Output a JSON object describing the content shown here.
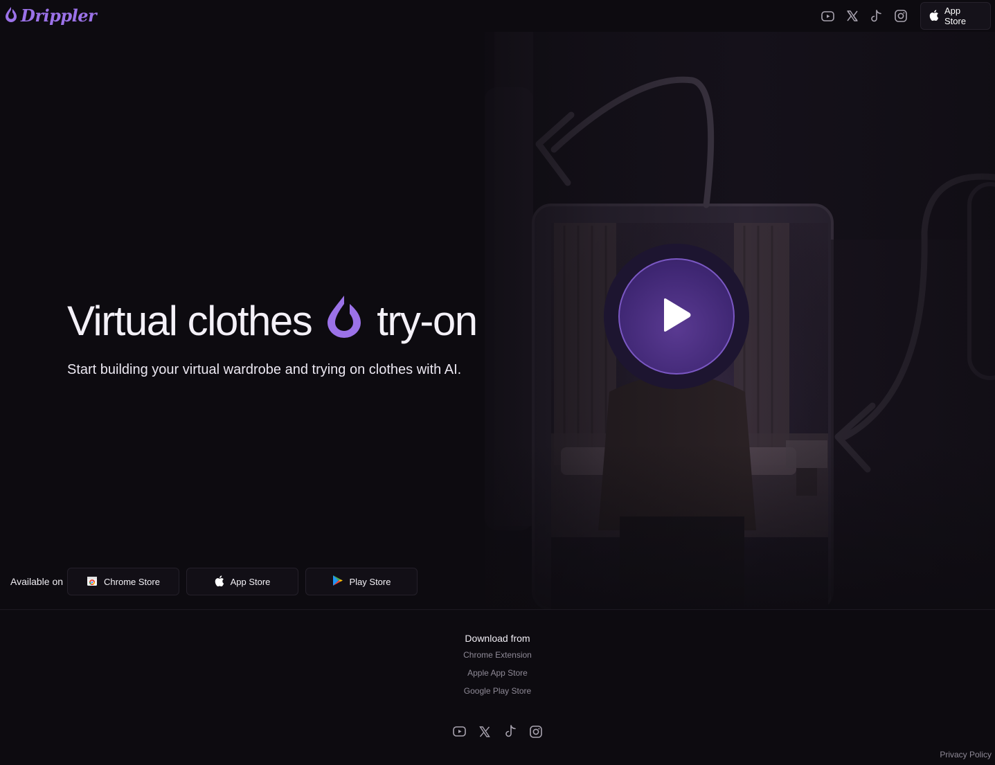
{
  "brand": {
    "name": "Drippler",
    "accent": "#9b72e8"
  },
  "header": {
    "social": [
      "youtube-icon",
      "x-icon",
      "tiktok-icon",
      "instagram-icon"
    ],
    "app_store_label": "App Store"
  },
  "hero": {
    "title_left": "Virtual clothes",
    "title_right": "try-on",
    "subtitle": "Start building your virtual wardrobe and trying on clothes with AI."
  },
  "available": {
    "label": "Available on",
    "stores": [
      {
        "label": "Chrome Store",
        "icon": "chrome-store-icon"
      },
      {
        "label": "App Store",
        "icon": "apple-icon"
      },
      {
        "label": "Play Store",
        "icon": "google-play-icon"
      }
    ]
  },
  "footer": {
    "heading": "Download from",
    "links": [
      "Chrome Extension",
      "Apple App Store",
      "Google Play Store"
    ],
    "social": [
      "youtube-icon",
      "x-icon",
      "tiktok-icon",
      "instagram-icon"
    ],
    "privacy": "Privacy Policy"
  }
}
